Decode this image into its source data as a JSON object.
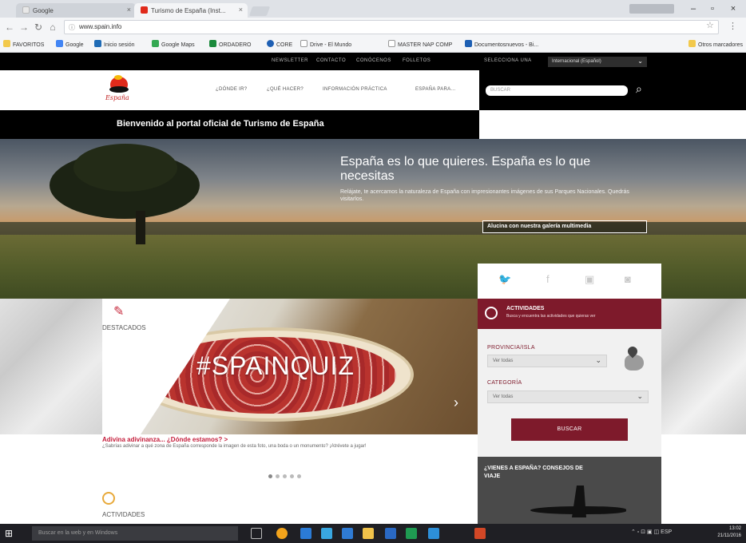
{
  "browser": {
    "tabs": [
      {
        "label": "Google",
        "active": false
      },
      {
        "label": "Turismo de España (Inst...",
        "active": true
      }
    ],
    "url": "www.spain.info",
    "bookmarks": [
      "FAVORITOS",
      "Google",
      "Inicio sesión",
      "Google Maps",
      "ORDADERO",
      "CORE",
      "Drive - El Mundo",
      "MASTER NAP COMP",
      "Documentosnuevos - Bi...",
      "Otros marcadores"
    ]
  },
  "site": {
    "top_links": [
      "NEWSLETTER",
      "CONTACTO",
      "CONÓCENOS",
      "FOLLETOS",
      "SELECCIONA UNA"
    ],
    "language": "Internacional (Español)",
    "logo_text": "España",
    "nav": [
      "¿DÓNDE IR?",
      "¿QUÉ HACER?",
      "INFORMACIÓN PRÁCTICA",
      "ESPAÑA PARA..."
    ],
    "search_placeholder": "BUSCAR",
    "welcome": "Bienvenido al portal oficial de Turismo de España",
    "hero": {
      "title": "España es lo que quieres. España es lo que necesitas",
      "desc": "Relájate, te acercamos la naturaleza de España con impresionantes imágenes de sus Parques Nacionales. Quedrás visitarlos.",
      "cta": "Alucina con nuestra galería multimedia"
    },
    "featured": {
      "label": "DESTACADOS",
      "slide_title": "#SPAINQUIZ",
      "headline": "Adivina adivinanza... ¿Dónde estamos? >",
      "text": "¿Sabrías adivinar a qué zona de España corresponde la imagen de esta foto, una boda o un monumento? ¡Atrévete a jugar!"
    },
    "activities_label": "ACTIVIDADES",
    "panel": {
      "social": [
        "twitter-icon",
        "facebook-icon",
        "youtube-icon",
        "instagram-icon"
      ],
      "act_title": "ACTIVIDADES",
      "act_sub": "Busca y encuentra las actividades que quieras ver",
      "province_label": "PROVINCIA/ISLA",
      "province_value": "Ver todas",
      "category_label": "CATEGORÍA",
      "category_value": "Ver todas",
      "search_button": "BUSCAR",
      "travel_title": "¿VIENES A ESPAÑA? CONSEJOS DE VIAJE"
    }
  },
  "taskbar": {
    "search": "Buscar en la web y en Windows",
    "tray": "ESP",
    "time": "13:02",
    "date": "21/11/2016"
  }
}
